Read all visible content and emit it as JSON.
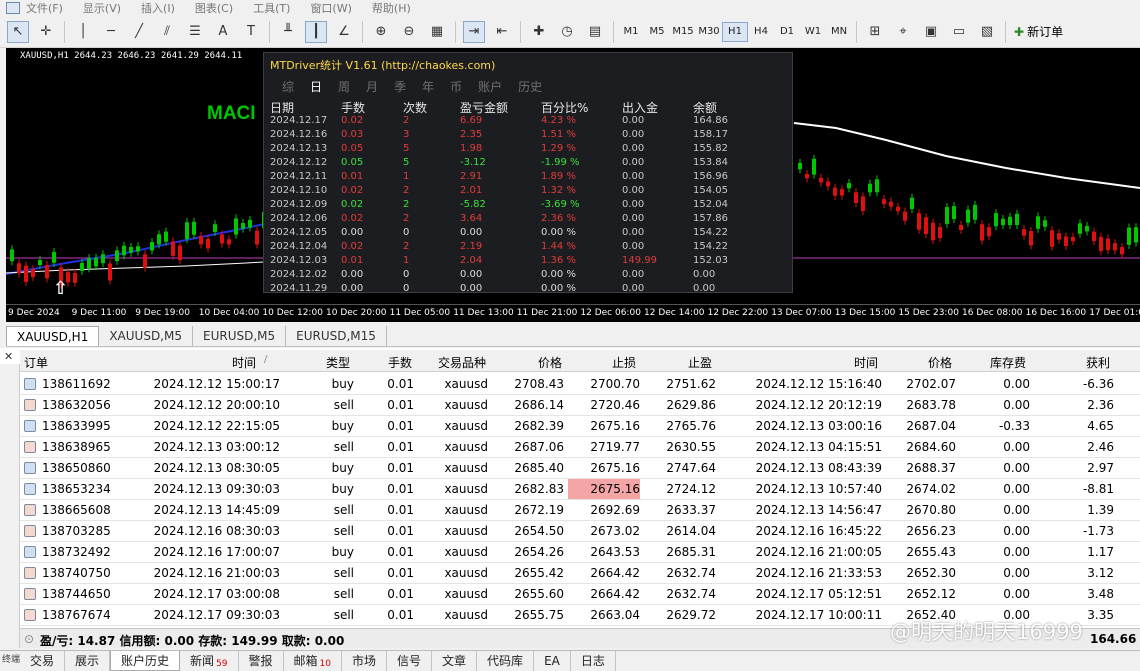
{
  "menu": [
    "文件(F)",
    "显示(V)",
    "插入(I)",
    "图表(C)",
    "工具(T)",
    "窗口(W)",
    "帮助(H)"
  ],
  "toolbar": {
    "timeframes": [
      "M1",
      "M5",
      "M15",
      "M30",
      "H1",
      "H4",
      "D1",
      "W1",
      "MN"
    ],
    "active_timeframe": "H1",
    "new_order_label": "新订单"
  },
  "chart": {
    "title": "XAUUSD,H1  2644.23 2646.23 2641.29 2644.11",
    "indicator_label": "MACI",
    "bull_color": "#00c800",
    "bear_color": "#e01010",
    "x_labels": [
      "9 Dec 2024",
      "9 Dec 11:00",
      "9 Dec 19:00",
      "10 Dec 04:00",
      "10 Dec 12:00",
      "10 Dec 20:00",
      "11 Dec 05:00",
      "11 Dec 13:00",
      "11 Dec 21:00",
      "12 Dec 06:00",
      "12 Dec 14:00",
      "12 Dec 22:00",
      "13 Dec 07:00",
      "13 Dec 15:00",
      "15 Dec 23:00",
      "16 Dec 08:00",
      "16 Dec 16:00",
      "17 Dec 01:00"
    ]
  },
  "popup": {
    "title": "MTDriver统计 V1.61 (http://chaokes.com)",
    "tabs": [
      "综",
      "日",
      "周",
      "月",
      "季",
      "年",
      "币",
      "账户",
      "历史"
    ],
    "active_tab": "日",
    "headers": [
      "日期",
      "手数",
      "次数",
      "盈亏金额",
      "百分比%",
      "出入金",
      "余额"
    ],
    "rows": [
      {
        "date": "2024.12.17",
        "lots": "0.02",
        "count": "2",
        "pnl": "6.69",
        "pct": "4.23 %",
        "io": "0.00",
        "bal": "164.86",
        "tone": "red"
      },
      {
        "date": "2024.12.16",
        "lots": "0.03",
        "count": "3",
        "pnl": "2.35",
        "pct": "1.51 %",
        "io": "0.00",
        "bal": "158.17",
        "tone": "red"
      },
      {
        "date": "2024.12.13",
        "lots": "0.05",
        "count": "5",
        "pnl": "1.98",
        "pct": "1.29 %",
        "io": "0.00",
        "bal": "155.82",
        "tone": "red"
      },
      {
        "date": "2024.12.12",
        "lots": "0.05",
        "count": "5",
        "pnl": "-3.12",
        "pct": "-1.99 %",
        "io": "0.00",
        "bal": "153.84",
        "tone": "grn"
      },
      {
        "date": "2024.12.11",
        "lots": "0.01",
        "count": "1",
        "pnl": "2.91",
        "pct": "1.89 %",
        "io": "0.00",
        "bal": "156.96",
        "tone": "red"
      },
      {
        "date": "2024.12.10",
        "lots": "0.02",
        "count": "2",
        "pnl": "2.01",
        "pct": "1.32 %",
        "io": "0.00",
        "bal": "154.05",
        "tone": "red"
      },
      {
        "date": "2024.12.09",
        "lots": "0.02",
        "count": "2",
        "pnl": "-5.82",
        "pct": "-3.69 %",
        "io": "0.00",
        "bal": "152.04",
        "tone": "grn"
      },
      {
        "date": "2024.12.06",
        "lots": "0.02",
        "count": "2",
        "pnl": "3.64",
        "pct": "2.36 %",
        "io": "0.00",
        "bal": "157.86",
        "tone": "red"
      },
      {
        "date": "2024.12.05",
        "lots": "0.00",
        "count": "0",
        "pnl": "0.00",
        "pct": "0.00 %",
        "io": "0.00",
        "bal": "154.22",
        "tone": "wht"
      },
      {
        "date": "2024.12.04",
        "lots": "0.02",
        "count": "2",
        "pnl": "2.19",
        "pct": "1.44 %",
        "io": "0.00",
        "bal": "154.22",
        "tone": "red"
      },
      {
        "date": "2024.12.03",
        "lots": "0.01",
        "count": "1",
        "pnl": "2.04",
        "pct": "1.36 %",
        "io": "149.99",
        "bal": "152.03",
        "tone": "red",
        "io_red": true
      },
      {
        "date": "2024.12.02",
        "lots": "0.00",
        "count": "0",
        "pnl": "0.00",
        "pct": "0.00 %",
        "io": "0.00",
        "bal": "0.00",
        "tone": "wht"
      },
      {
        "date": "2024.11.29",
        "lots": "0.00",
        "count": "0",
        "pnl": "0.00",
        "pct": "0.00 %",
        "io": "0.00",
        "bal": "0.00",
        "tone": "wht"
      }
    ]
  },
  "chart_tabs": [
    "XAUUSD,H1",
    "XAUUSD,M5",
    "EURUSD,M5",
    "EURUSD,M15"
  ],
  "active_chart_tab": "XAUUSD,H1",
  "table": {
    "headers": [
      "订单",
      "时间",
      "类型",
      "手数",
      "交易品种",
      "价格",
      "止损",
      "止盈",
      "时间",
      "价格",
      "库存费",
      "获利"
    ],
    "rows": [
      [
        "138611692",
        "2024.12.12 15:00:17",
        "buy",
        "0.01",
        "xauusd",
        "2708.43",
        "2700.70",
        "2751.62",
        "2024.12.12 15:16:40",
        "2702.07",
        "0.00",
        "-6.36"
      ],
      [
        "138632056",
        "2024.12.12 20:00:10",
        "sell",
        "0.01",
        "xauusd",
        "2686.14",
        "2720.46",
        "2629.86",
        "2024.12.12 20:12:19",
        "2683.78",
        "0.00",
        "2.36"
      ],
      [
        "138633995",
        "2024.12.12 22:15:05",
        "buy",
        "0.01",
        "xauusd",
        "2682.39",
        "2675.16",
        "2765.76",
        "2024.12.13 03:00:16",
        "2687.04",
        "-0.33",
        "4.65"
      ],
      [
        "138638965",
        "2024.12.13 03:00:12",
        "sell",
        "0.01",
        "xauusd",
        "2687.06",
        "2719.77",
        "2630.55",
        "2024.12.13 04:15:51",
        "2684.60",
        "0.00",
        "2.46"
      ],
      [
        "138650860",
        "2024.12.13 08:30:05",
        "buy",
        "0.01",
        "xauusd",
        "2685.40",
        "2675.16",
        "2747.64",
        "2024.12.13 08:43:39",
        "2688.37",
        "0.00",
        "2.97"
      ],
      [
        "138653234",
        "2024.12.13 09:30:03",
        "buy",
        "0.01",
        "xauusd",
        "2682.83",
        "2675.16",
        "2724.12",
        "2024.12.13 10:57:40",
        "2674.02",
        "0.00",
        "-8.81"
      ],
      [
        "138665608",
        "2024.12.13 14:45:09",
        "sell",
        "0.01",
        "xauusd",
        "2672.19",
        "2692.69",
        "2633.37",
        "2024.12.13 14:56:47",
        "2670.80",
        "0.00",
        "1.39"
      ],
      [
        "138703285",
        "2024.12.16 08:30:03",
        "sell",
        "0.01",
        "xauusd",
        "2654.50",
        "2673.02",
        "2614.04",
        "2024.12.16 16:45:22",
        "2656.23",
        "0.00",
        "-1.73"
      ],
      [
        "138732492",
        "2024.12.16 17:00:07",
        "buy",
        "0.01",
        "xauusd",
        "2654.26",
        "2643.53",
        "2685.31",
        "2024.12.16 21:00:05",
        "2655.43",
        "0.00",
        "1.17"
      ],
      [
        "138740750",
        "2024.12.16 21:00:03",
        "sell",
        "0.01",
        "xauusd",
        "2655.42",
        "2664.42",
        "2632.74",
        "2024.12.16 21:33:53",
        "2652.30",
        "0.00",
        "3.12"
      ],
      [
        "138744650",
        "2024.12.17 03:00:08",
        "sell",
        "0.01",
        "xauusd",
        "2655.60",
        "2664.42",
        "2632.74",
        "2024.12.17 05:12:51",
        "2652.12",
        "0.00",
        "3.48"
      ],
      [
        "138767674",
        "2024.12.17 09:30:03",
        "sell",
        "0.01",
        "xauusd",
        "2655.75",
        "2663.04",
        "2629.72",
        "2024.12.17 10:00:11",
        "2652.40",
        "0.00",
        "3.35"
      ]
    ],
    "highlight_row": 5
  },
  "summary": {
    "text": "盈/亏: 14.87  信用额: 0.00  存款: 149.99  取款: 0.00",
    "total": "164.66"
  },
  "bottom_tabs": [
    {
      "label": "交易",
      "badge": ""
    },
    {
      "label": "展示",
      "badge": ""
    },
    {
      "label": "账户历史",
      "badge": ""
    },
    {
      "label": "新闻",
      "badge": "59"
    },
    {
      "label": "警报",
      "badge": ""
    },
    {
      "label": "邮箱",
      "badge": "10"
    },
    {
      "label": "市场",
      "badge": ""
    },
    {
      "label": "信号",
      "badge": ""
    },
    {
      "label": "文章",
      "badge": ""
    },
    {
      "label": "代码库",
      "badge": ""
    },
    {
      "label": "EA",
      "badge": ""
    },
    {
      "label": "日志",
      "badge": ""
    }
  ],
  "active_bottom_tab": "账户历史",
  "side_label": "终端",
  "watermark": "@明天的明天16999"
}
